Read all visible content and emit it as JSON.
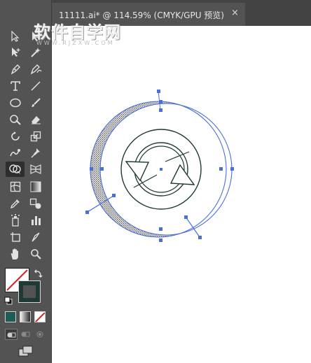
{
  "app": {
    "document_tab": {
      "title": "11111.ai* @ 114.59% (CMYK/GPU 预览)",
      "close_glyph": "×"
    },
    "watermark": {
      "text": "软件自学网",
      "subtext": "WWW.RJZXW.COM"
    }
  },
  "toolbar": {
    "tools": [
      "selection-tool",
      "direct-selection-tool",
      "group-selection-tool",
      "magic-wand-tool",
      "pen-tool",
      "curvature-tool",
      "type-tool",
      "line-segment-tool",
      "ellipse-tool",
      "paintbrush-tool",
      "shaper-tool",
      "eraser-tool",
      "rotate-tool",
      "scale-tool",
      "warp-tool",
      "puppet-warp-tool",
      "shape-builder-tool",
      "perspective-grid-tool",
      "mesh-tool",
      "gradient-tool",
      "eyedropper-tool",
      "blend-tool",
      "symbol-sprayer-tool",
      "column-graph-tool",
      "artboard-tool",
      "slice-tool",
      "hand-tool",
      "zoom-tool"
    ],
    "active_tool": "shape-builder-tool",
    "fill_color": "#ffffff",
    "stroke_color": "#1f3a35",
    "mode_colors": [
      "#1f5c55",
      "#808080",
      "none"
    ]
  },
  "colors": {
    "selection": "#4a6fd8",
    "artwork_stroke": "#1f3a35"
  }
}
